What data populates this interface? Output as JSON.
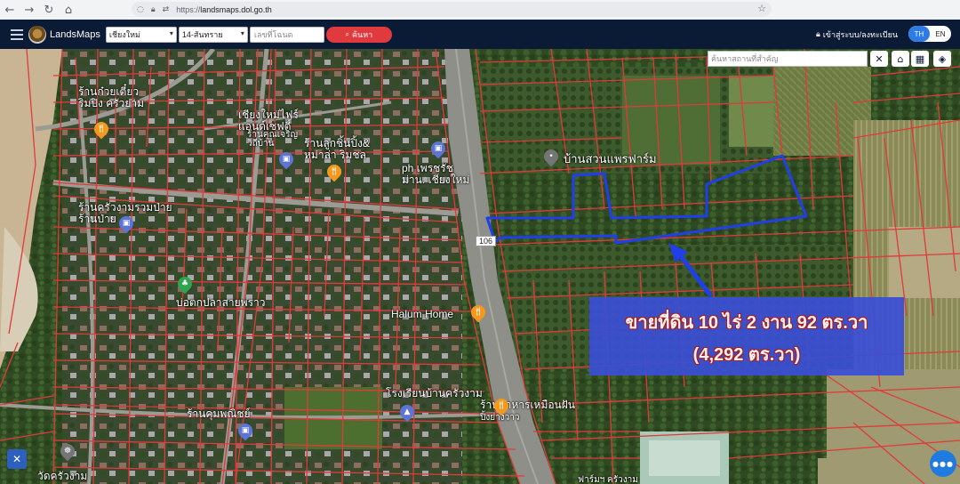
{
  "browser": {
    "back_icon": "←",
    "forward_icon": "→",
    "reload_icon": "↻",
    "home_icon": "⌂",
    "url_prefix": "https://",
    "url_host": "landsmaps.dol.go.th",
    "star_icon": "☆"
  },
  "header": {
    "app_name": "LandsMaps",
    "province_select": "เชียงใหม่",
    "district_select": "14-สันทราย",
    "parcel_placeholder": "เลขที่โฉนด",
    "search_label": "ค้นหา",
    "search_icon": "🔍",
    "login_label": "เข้าสู่ระบบ/ลงทะเบียน",
    "login_icon": "🔒",
    "lang_th": "TH",
    "lang_en": "EN"
  },
  "map": {
    "place_search_placeholder": "ค้นหาสถานที่สำคัญ",
    "clear_icon": "✕",
    "home_icon": "⌂",
    "grid_icon": "▦",
    "layers_icon": "◈",
    "road_badge": "106",
    "places": {
      "p1": "ร้านก๋วยเตี๋ยว",
      "p1b": "ริมปิง ครัวยาม",
      "p2": "เชียงใหม่ไฟร์",
      "p2b": "แอนด์เซฟตี้",
      "p2c": "ร้านคุณเจริญ",
      "p2d": "วิถีบ้าน",
      "p3": "ร้านลูกชิ้นปิ้ง&",
      "p3b": "หม่าล่า ริมชล",
      "p4": "ph เพรชรัช",
      "p4b": "ม่าน. เชียงใหม่",
      "p5": "บ้านสวนแพรฟาร์ม",
      "p6": "ร้านครัวงามรวมป่าย",
      "p6b": "ร้านป่าย",
      "p7": "บ่อตกปลาสายพราว",
      "p8": "Halum Home",
      "p9": "โรงเรียนบ้านครัวงาม",
      "p10": "ร้านคุมพณิชย์",
      "p11": "ร้านอาหารเหมือนฝัน",
      "p11b": "ปิ้งย่างวาว",
      "p12": "วัดครัวงาม",
      "p13": "ฟาร์มฯ ครัวงาม"
    },
    "sale": {
      "line1": "ขายที่ดิน 10 ไร่ 2 งาน 92 ตร.วา",
      "line2": "(4,292 ตร.วา)"
    },
    "tool_icon": "✕",
    "chat_icon": "●●●"
  },
  "colors": {
    "parcel_line": "#e03a3a",
    "highlight": "#1f3fe8",
    "header_bg": "#0b1a35",
    "sale_box": "#3a4fd6"
  }
}
